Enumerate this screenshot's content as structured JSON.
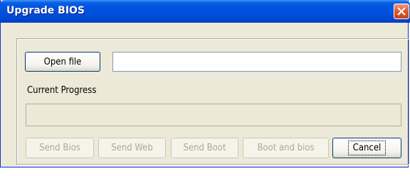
{
  "window": {
    "title": "Upgrade BIOS",
    "close_icon": "close-icon"
  },
  "file": {
    "open_button_label": "Open file",
    "path_value": ""
  },
  "progress": {
    "label": "Current Progress",
    "value": 0
  },
  "actions": [
    {
      "label": "Send Bios",
      "enabled": false
    },
    {
      "label": "Send Web",
      "enabled": false
    },
    {
      "label": "Send Boot",
      "enabled": false
    },
    {
      "label": "Boot and bios",
      "enabled": false
    },
    {
      "label": "Cancel",
      "enabled": true
    }
  ],
  "colors": {
    "titlebar": "#0054e3",
    "dialog_bg": "#ece9d8",
    "close_button": "#e05a32",
    "disabled_text": "#aca899"
  }
}
